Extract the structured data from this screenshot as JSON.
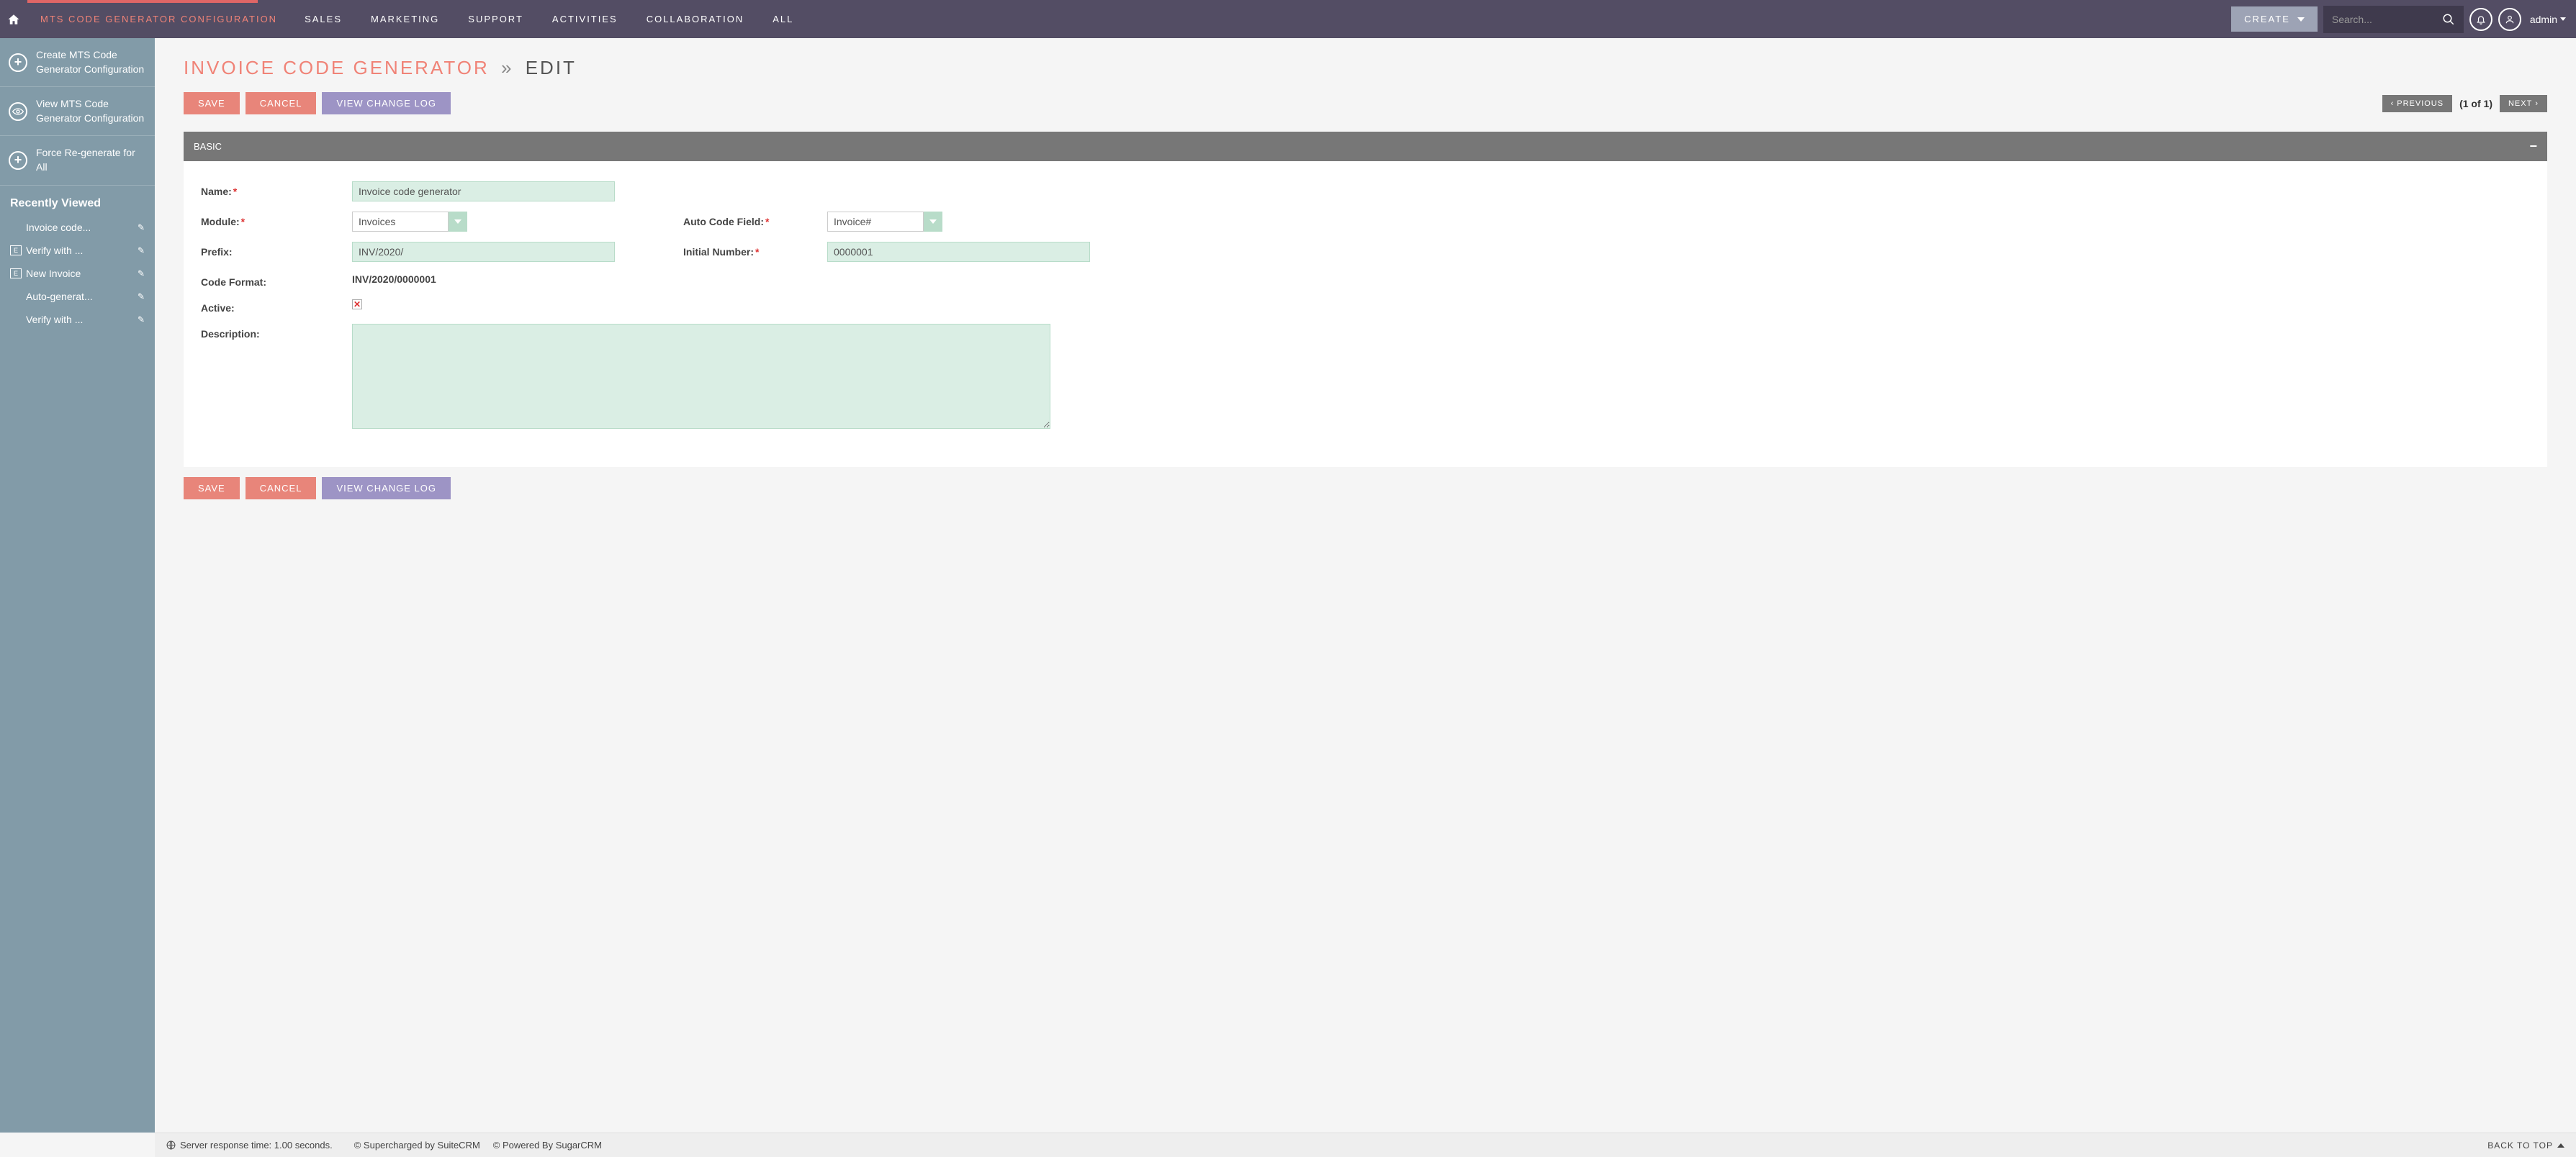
{
  "header": {
    "brand": "MTS CODE GENERATOR CONFIGURATION",
    "nav": [
      "SALES",
      "MARKETING",
      "SUPPORT",
      "ACTIVITIES",
      "COLLABORATION",
      "ALL"
    ],
    "create": "CREATE",
    "search_placeholder": "Search...",
    "user": "admin"
  },
  "sidebar": {
    "actions": [
      {
        "label": "Create MTS Code Generator Configuration",
        "icon": "plus"
      },
      {
        "label": "View MTS Code Generator Configuration",
        "icon": "eye"
      },
      {
        "label": "Force Re-generate for All",
        "icon": "plus"
      }
    ],
    "recent_heading": "Recently Viewed",
    "recent": [
      {
        "label": "Invoice code...",
        "icon": ""
      },
      {
        "label": "Verify with ...",
        "icon": "E"
      },
      {
        "label": "New Invoice",
        "icon": "E"
      },
      {
        "label": "Auto-generat...",
        "icon": ""
      },
      {
        "label": "Verify with ...",
        "icon": ""
      }
    ]
  },
  "page": {
    "title_main": "INVOICE CODE GENERATOR",
    "title_sep": "»",
    "title_mode": "EDIT",
    "buttons": {
      "save": "SAVE",
      "cancel": "CANCEL",
      "log": "VIEW CHANGE LOG"
    },
    "pager": {
      "prev": "PREVIOUS",
      "info": "(1 of 1)",
      "next": "NEXT"
    }
  },
  "panel": {
    "title": "BASIC",
    "labels": {
      "name": "Name:",
      "module": "Module:",
      "auto_code_field": "Auto Code Field:",
      "prefix": "Prefix:",
      "initial_number": "Initial Number:",
      "code_format": "Code Format:",
      "active": "Active:",
      "description": "Description:"
    },
    "values": {
      "name": "Invoice code generator",
      "module": "Invoices",
      "auto_code_field": "Invoice#",
      "prefix": "INV/2020/",
      "initial_number": "0000001",
      "code_format": "INV/2020/0000001",
      "active_checked": false,
      "description": ""
    }
  },
  "footer": {
    "response": "Server response time: 1.00 seconds.",
    "supercharged": "© Supercharged by SuiteCRM",
    "powered": "© Powered By SugarCRM",
    "backtop": "BACK TO TOP"
  }
}
